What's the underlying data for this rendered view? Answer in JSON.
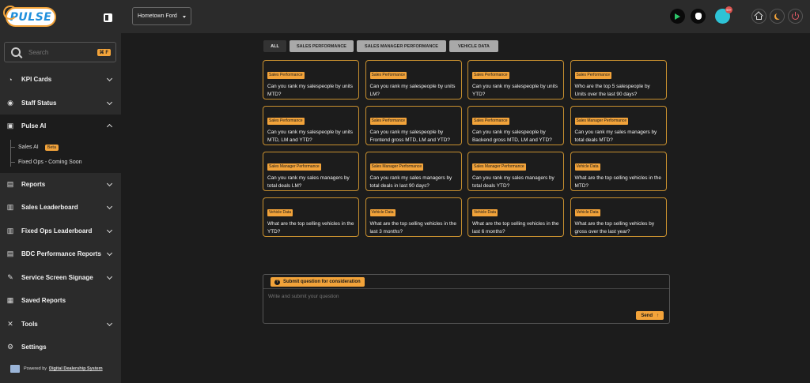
{
  "brand": {
    "logo_text": "PULSE"
  },
  "search": {
    "placeholder": "Search",
    "shortcut": "⌘ F"
  },
  "sidebar": {
    "items": [
      {
        "label": "KPI Cards",
        "icon": "speedometer-icon"
      },
      {
        "label": "Staff Status",
        "icon": "user-circle-icon"
      },
      {
        "label": "Pulse AI",
        "icon": "ai-chip-icon"
      },
      {
        "label": "Reports",
        "icon": "document-icon"
      },
      {
        "label": "Sales Leaderboard",
        "icon": "bar-chart-icon"
      },
      {
        "label": "Fixed Ops Leaderboard",
        "icon": "bar-chart-icon"
      },
      {
        "label": "BDC Performance Reports",
        "icon": "document-chart-icon"
      },
      {
        "label": "Service Screen Signage",
        "icon": "wrench-icon"
      },
      {
        "label": "Saved Reports",
        "icon": "save-icon"
      },
      {
        "label": "Tools",
        "icon": "tools-icon"
      },
      {
        "label": "Settings",
        "icon": "gear-icon"
      }
    ],
    "pulse_ai_sub": [
      {
        "label": "Sales AI",
        "badge": "Beta"
      },
      {
        "label": "Fixed Ops - Coming Soon"
      }
    ],
    "footer": {
      "powered_by": "Powered by",
      "company": "Digital Dealership System"
    }
  },
  "topbar": {
    "dealer": "Hometown Ford",
    "avatar_badge": "99+"
  },
  "tabs": [
    "ALL",
    "SALES PERFORMANCE",
    "SALES MANAGER PERFORMANCE",
    "VEHICLE DATA"
  ],
  "cards": [
    {
      "tag": "Sales Performance",
      "question": "Can you rank my salespeople by units MTD?"
    },
    {
      "tag": "Sales Performance",
      "question": "Can you rank my salespeople by units LM?"
    },
    {
      "tag": "Sales Performance",
      "question": "Can you rank my salespeople by units YTD?"
    },
    {
      "tag": "Sales Performance",
      "question": "Who are the top 5 salespeople by Units over the last 90 days?"
    },
    {
      "tag": "Sales Performance",
      "question": "Can you rank my salespeople by units MTD, LM and YTD?"
    },
    {
      "tag": "Sales Performance",
      "question": "Can you rank my salespeople by Frontend gross MTD, LM and YTD?"
    },
    {
      "tag": "Sales Performance",
      "question": "Can you rank my salespeople by Backend gross MTD, LM and YTD?"
    },
    {
      "tag": "Sales Manager Performance",
      "question": "Can you rank my sales managers by total deals MTD?"
    },
    {
      "tag": "Sales Manager Performance",
      "question": "Can you rank my sales managers by total deals LM?"
    },
    {
      "tag": "Sales Manager Performance",
      "question": "Can you rank my sales managers by total deals in last 90 days?"
    },
    {
      "tag": "Sales Manager Performance",
      "question": "Can you rank my sales managers by total deals YTD?"
    },
    {
      "tag": "Vehicle Data",
      "question": "What are the top selling vehicles in the MTD?"
    },
    {
      "tag": "Vehicle Data",
      "question": "What are the top selling vehicles in the YTD?"
    },
    {
      "tag": "Vehicle Data",
      "question": "What are the top selling vehicles in the last 3 months?"
    },
    {
      "tag": "Vehicle Data",
      "question": "What are the top selling vehicles in the last 6 months?"
    },
    {
      "tag": "Vehicle Data",
      "question": "What are the top selling vehicles by gross over the last year?"
    }
  ],
  "submit": {
    "title": "Submit question for consideration",
    "placeholder": "Write and submit your question",
    "send_label": "Send"
  },
  "colors": {
    "accent": "#f2a33a",
    "sidebar_bg": "#2b2b2b",
    "main_bg": "#1c1c1c"
  }
}
